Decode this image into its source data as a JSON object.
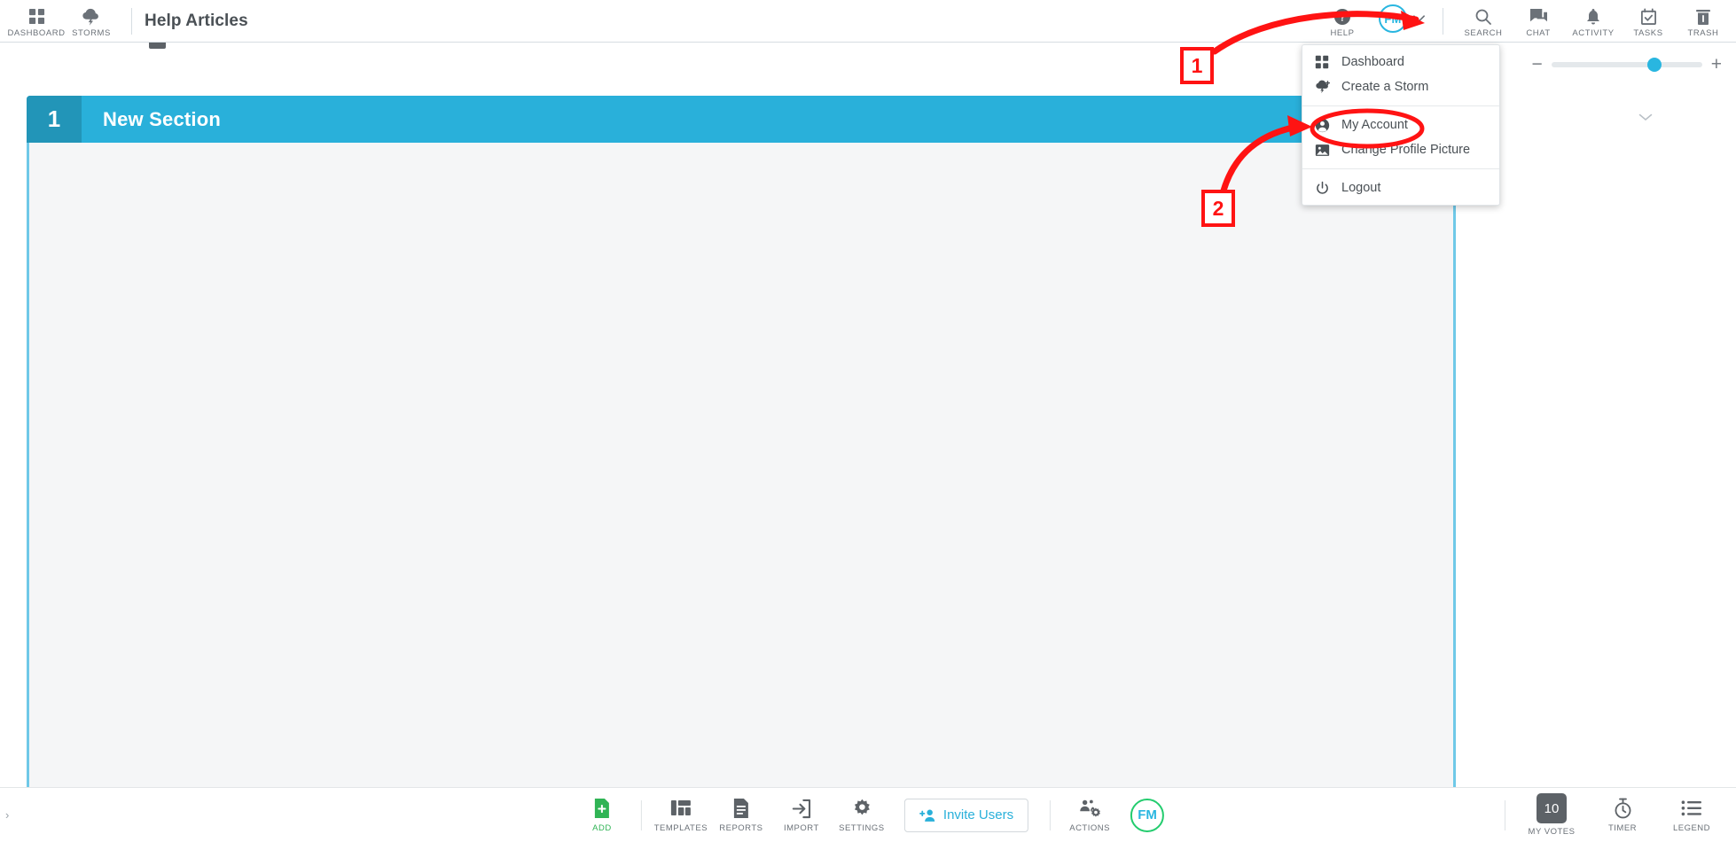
{
  "topbar": {
    "left_items": [
      {
        "label": "DASHBOARD",
        "icon": "grid-icon"
      },
      {
        "label": "STORMS",
        "icon": "cloud-storm-icon"
      }
    ],
    "page_title": "Help Articles",
    "right_items": [
      {
        "label": "HELP",
        "icon": "help-circle-icon"
      },
      {
        "label": "SEARCH",
        "icon": "search-icon"
      },
      {
        "label": "CHAT",
        "icon": "chat-icon"
      },
      {
        "label": "ACTIVITY",
        "icon": "bell-icon"
      },
      {
        "label": "TASKS",
        "icon": "calendar-check-icon"
      },
      {
        "label": "TRASH",
        "icon": "trash-icon"
      }
    ],
    "avatar_initials": "FM",
    "avatar_border_color": "#29b6e0",
    "caret_icon": "chevron-down-icon"
  },
  "subbar": {
    "zoom_minus": "−",
    "zoom_plus": "+",
    "thumb_color": "#29b6e0",
    "collapse_chevron": "⌄"
  },
  "section": {
    "number": "1",
    "title": "New Section",
    "header_color": "#29b0da",
    "number_color": "#2295b8",
    "edit_icon": "edit-square-icon"
  },
  "dropdown": {
    "groups": [
      [
        {
          "label": "Dashboard",
          "icon": "grid-icon"
        },
        {
          "label": "Create a Storm",
          "icon": "cloud-storm-plus-icon"
        }
      ],
      [
        {
          "label": "My Account",
          "icon": "user-circle-icon"
        },
        {
          "label": "Change Profile Picture",
          "icon": "image-icon"
        }
      ],
      [
        {
          "label": "Logout",
          "icon": "power-icon"
        }
      ]
    ]
  },
  "bottombar": {
    "items": [
      {
        "label": "ADD",
        "icon": "file-plus-icon",
        "accent": "#30b455"
      },
      {
        "label": "TEMPLATES",
        "icon": "layout-icon"
      },
      {
        "label": "REPORTS",
        "icon": "document-icon"
      },
      {
        "label": "IMPORT",
        "icon": "import-arrow-icon"
      },
      {
        "label": "SETTINGS",
        "icon": "gear-icon"
      }
    ],
    "invite_label": "Invite Users",
    "invite_icon": "person-plus-icon",
    "invite_color": "#29b0da",
    "actions_label": "ACTIONS",
    "actions_icon": "people-gear-icon",
    "avatar_initials": "FM",
    "avatar_border_color": "#23cc6e",
    "right_items": [
      {
        "label": "MY VOTES",
        "value": "10",
        "icon": "votes-badge"
      },
      {
        "label": "TIMER",
        "icon": "stopwatch-icon"
      },
      {
        "label": "LEGEND",
        "icon": "list-icon"
      }
    ],
    "left_chevron": "›"
  },
  "annotations": {
    "color": "#ff1313",
    "markers": [
      {
        "label": "1"
      },
      {
        "label": "2"
      }
    ]
  }
}
